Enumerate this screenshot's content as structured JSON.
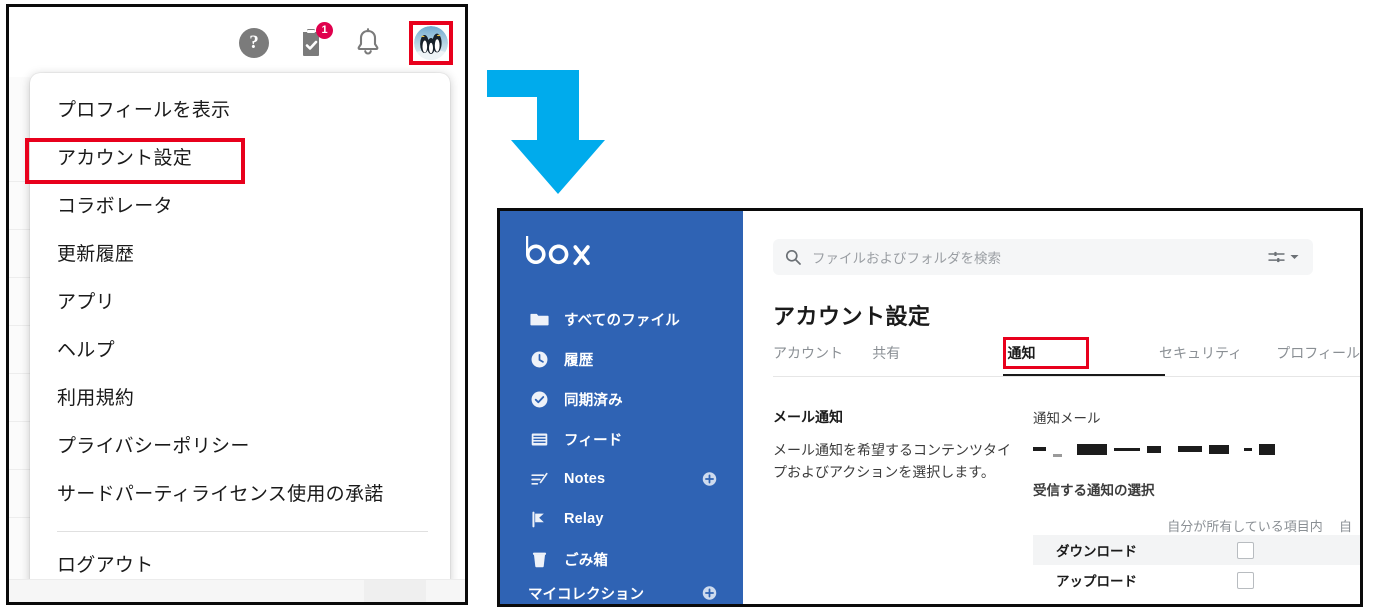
{
  "left_panel": {
    "topbar": {
      "help_icon": "help-circle-icon",
      "tasks_icon": "clipboard-check-icon",
      "tasks_badge": "1",
      "notifications_icon": "bell-icon",
      "avatar_icon": "user-avatar-penguins"
    },
    "menu": {
      "items": [
        {
          "label": "プロフィールを表示",
          "highlighted": false
        },
        {
          "label": "アカウント設定",
          "highlighted": true
        },
        {
          "label": "コラボレータ",
          "highlighted": false
        },
        {
          "label": "更新履歴",
          "highlighted": false
        },
        {
          "label": "アプリ",
          "highlighted": false
        },
        {
          "label": "ヘルプ",
          "highlighted": false
        },
        {
          "label": "利用規約",
          "highlighted": false
        },
        {
          "label": "プライバシーポリシー",
          "highlighted": false
        },
        {
          "label": "サードパーティライセンス使用の承諾",
          "highlighted": false
        }
      ],
      "logout_label": "ログアウト"
    }
  },
  "arrow": {
    "icon": "elbow-arrow-right-down-icon",
    "color": "#00abec"
  },
  "right_panel": {
    "sidebar": {
      "logo": "box",
      "items": [
        {
          "label": "すべてのファイル",
          "icon": "folder-icon",
          "plus": false
        },
        {
          "label": "履歴",
          "icon": "clock-icon",
          "plus": false
        },
        {
          "label": "同期済み",
          "icon": "check-circle-icon",
          "plus": false
        },
        {
          "label": "フィード",
          "icon": "feed-icon",
          "plus": false
        },
        {
          "label": "Notes",
          "icon": "notes-icon",
          "plus": true
        },
        {
          "label": "Relay",
          "icon": "relay-icon",
          "plus": false
        },
        {
          "label": "ごみ箱",
          "icon": "trash-icon",
          "plus": false
        }
      ],
      "collections": {
        "label": "マイコレクション",
        "plus": true
      }
    },
    "search": {
      "placeholder": "ファイルおよびフォルダを検索",
      "icon": "search-icon",
      "filter_icon": "sliders-icon",
      "caret_icon": "chevron-down-icon"
    },
    "page_title": "アカウント設定",
    "tabs": [
      {
        "label": "アカウント",
        "active": false
      },
      {
        "label": "共有",
        "active": false
      },
      {
        "label": "通知",
        "active": true
      },
      {
        "label": "セキュリティ",
        "active": false
      },
      {
        "label": "プロフィール",
        "active": false
      }
    ],
    "email_notifications": {
      "heading": "メール通知",
      "body": "メール通知を希望するコンテンツタイプおよびアクションを選択します。"
    },
    "notification_email": {
      "label": "通知メール",
      "value_redacted": true
    },
    "receive_notifications": {
      "label": "受信する通知の選択",
      "columns": [
        "自分が所有している項目内",
        "自"
      ],
      "rows": [
        {
          "label": "ダウンロード",
          "checked": [
            false,
            false
          ]
        },
        {
          "label": "アップロード",
          "checked": [
            false,
            false
          ]
        }
      ]
    }
  },
  "colors": {
    "highlight_red": "#e8001c",
    "box_blue": "#2f63b4",
    "arrow_blue": "#00abec",
    "badge_red": "#e0004d"
  }
}
